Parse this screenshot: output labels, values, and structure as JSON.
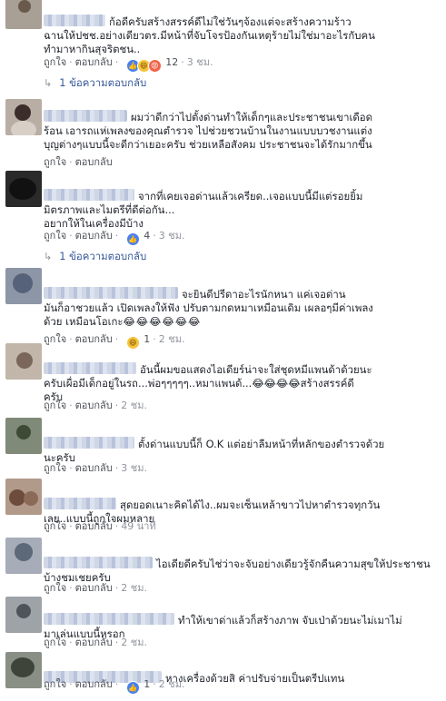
{
  "ui": {
    "like": "ถูกใจ",
    "reply": "ตอบกลับ",
    "sep": "·",
    "arrow": "↳"
  },
  "comments": [
    {
      "text": "ก้อดีครับสร้างสรรค์ดีไม่ใช่วันๆจ้องแต่จะสร้างความร้าว\nฉานให้ปชช.อย่างเดียวตร.มีหน้าที่จับโจรป้องกันเหตุร้ายไม่ใช่มาอะไรกับคน\nทำมาหากินสุจริตชน..",
      "reaction_count": "12",
      "time": "3 ชม.",
      "replies": "1 ข้อความตอบกลับ"
    },
    {
      "text": "ผมว่าดีกว่าไปตั้งด่านทำให้เด็กๆและประชาชนเขาเดือด\nร้อน เอารถแห่เพลงของคุณตำรวจ ไปช่วยชวนบ้านในงานแบบบวชงานแต่ง\nบุญต่างๆแบบนี้จะดีกว่าเยอะครับ ช่วยเหลือสังคม ประชาชนจะได้รักมากขึ้น",
      "reaction_count": "",
      "time": "",
      "replies": ""
    },
    {
      "text": "จากที่เคยเจอด่านแล้วเครียด..เจอแบบนี้มีแต่รอยยิ้ม\nมิตรภาพและไมตรีที่ดีต่อกัน...\nอยากให้ในเครื่องมีบ้าง",
      "reaction_count": "4",
      "time": "3 ชม.",
      "replies": "1 ข้อความตอบกลับ"
    },
    {
      "text": "จะยินดีปรีดาอะไรนักหนา แค่เจอด่าน\nมันก็อาชวยแล้ว เปิดเพลงให้ฟัง ปรับตามกดหมาเหมือนเดิม เผลอๆมีค่าเพลง\nด้วย เหมือนโอเกะ",
      "emoji_row": "😂😂😂😂😂😂",
      "reaction_count": "1",
      "time": "2 ชม.",
      "replies": ""
    },
    {
      "text": "อันนี้ผมขอแสดงไอเดียร์น่าจะใส่ชุดหมีแพนด้าด้วยนะ\nครับเผื่อมีเด็กอยู่ในรถ...พ่อๆๆๆๆๆ..หมาแพนด้...",
      "emoji_row": "😂😂😂😂",
      "tail": "สร้างสรรค์ดี\nครับ",
      "reaction_count": "",
      "time": "2 ชม.",
      "replies": ""
    },
    {
      "text": "ตั้งด่านแบบนี้ก็ O.K แต่อย่าลืมหน้าที่หลักของตำรวจด้วย\nนะครับ",
      "reaction_count": "",
      "time": "3 ชม.",
      "replies": ""
    },
    {
      "text": "สุดยอดเนาะคิดได้ไง..ผมจะเซ็นเหล้าขาวไปหาตำรวจทุกวัน\nเลย..แบบนี้ถูกใจผมหลาย",
      "reaction_count": "",
      "time": "49 นาที",
      "replies": ""
    },
    {
      "text": "ไอเดียดีครับไช่ว่าจะจับอย่างเดียวรู้จักคืนความสุขให้ประชาชน\nบ้างชมเชยครับ",
      "reaction_count": "",
      "time": "2 ชม.",
      "replies": ""
    },
    {
      "text": "ทำให้เขาด่าแล้วก็สร้างภาพ จับเป่าด้วยนะไม่เมาไม่\nมาเล่นแบบนี้หรอก",
      "reaction_count": "",
      "time": "2 ชม.",
      "replies": ""
    },
    {
      "text": "หางเครื่องด้วยสิ ค่าปรับจ่ายเป็นตรีปแทน",
      "reaction_count": "1",
      "time": "2 ชม.",
      "replies": ""
    }
  ]
}
